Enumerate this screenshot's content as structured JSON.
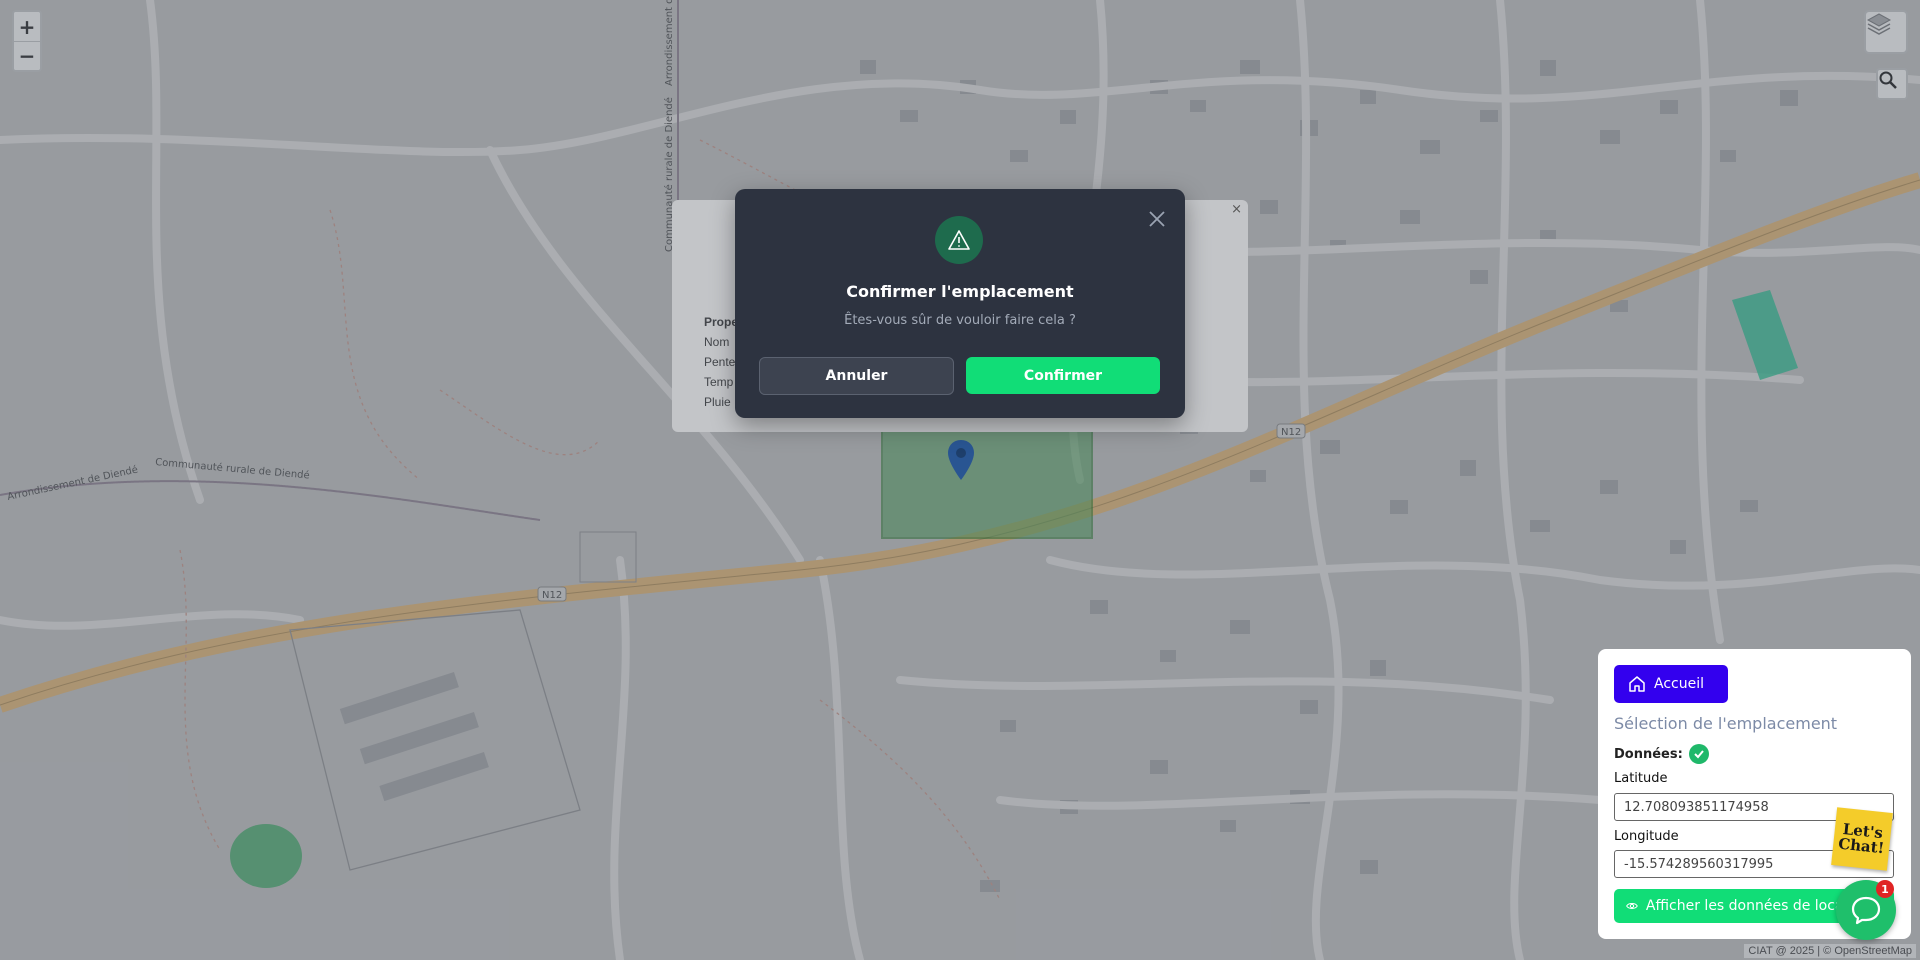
{
  "map": {
    "zoom_in": "+",
    "zoom_out": "−",
    "road_label_1": "N12",
    "road_label_2": "N12",
    "admin_label_1": "Communauté rurale de Diendé",
    "admin_label_2": "Arrondissement de Diendé",
    "admin_label_3": "Communauté rurale de Diendé",
    "admin_label_4": "Arrondissement de",
    "attribution": "CIAT @ 2025 | © OpenStreetMap",
    "icons": {
      "layers": "layers-icon",
      "search": "search-icon",
      "marker": "map-pin-icon"
    }
  },
  "property_popup": {
    "close": "×",
    "title": "Prope",
    "rows": [
      "Nom",
      "Pente",
      "Temp",
      "Pluie"
    ]
  },
  "dialog": {
    "title": "Confirmer l'emplacement",
    "message": "Êtes-vous sûr de vouloir faire cela ?",
    "cancel_label": "Annuler",
    "confirm_label": "Confirmer",
    "icon": "warning-icon",
    "colors": {
      "background": "#2d3340",
      "confirm": "#11dd77",
      "icon_bg": "#1e6b4d"
    }
  },
  "panel": {
    "home_label": "Accueil",
    "selection_title": "Sélection de l'emplacement",
    "data_label": "Données:",
    "latitude_label": "Latitude",
    "latitude_value": "12.708093851174958",
    "longitude_label": "Longitude",
    "longitude_value": "-15.574289560317995",
    "show_data_label": "Afficher les données de localisation",
    "colors": {
      "home": "#3300ee",
      "show": "#11dd77"
    }
  },
  "chat": {
    "sticker_text": "Let's Chat!",
    "badge_count": "1"
  }
}
